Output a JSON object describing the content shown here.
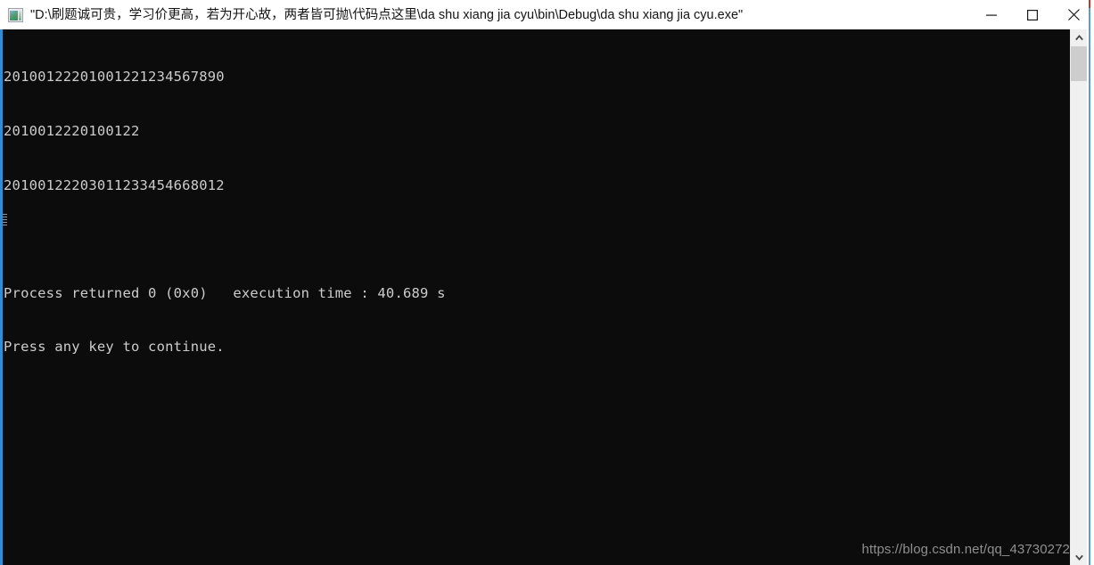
{
  "window": {
    "icon_name": "console-app-icon",
    "title": "\"D:\\刷题诚可贵，学习价更高，若为开心故，两者皆可抛\\代码点这里\\da shu xiang jia cyu\\bin\\Debug\\da shu xiang jia cyu.exe\"",
    "controls": {
      "minimize_label": "Minimize",
      "maximize_label": "Maximize",
      "close_label": "Close"
    }
  },
  "console": {
    "background_color": "#0c0c0c",
    "text_color": "#cccccc",
    "lines": [
      "20100122201001221234567890",
      "2010012220100122",
      "20100122203011233454668012",
      "",
      "Process returned 0 (0x0)   execution time : 40.689 s",
      "Press any key to continue."
    ],
    "output_line_1": "20100122201001221234567890",
    "output_line_2": "2010012220100122",
    "output_line_3": "20100122203011233454668012",
    "process_returned_line": "Process returned 0 (0x0)   execution time : 40.689 s",
    "press_any_key_line": "Press any key to continue.",
    "exit_code": "0",
    "exit_code_hex": "0x0",
    "execution_time": "40.689 s"
  },
  "scrollbar": {
    "up_arrow_name": "scroll-up-arrow",
    "down_arrow_name": "scroll-down-arrow",
    "thumb_color": "#cdcdcd",
    "track_color": "#f0f0f0"
  },
  "watermark": {
    "text": "https://blog.csdn.net/qq_43730272"
  }
}
